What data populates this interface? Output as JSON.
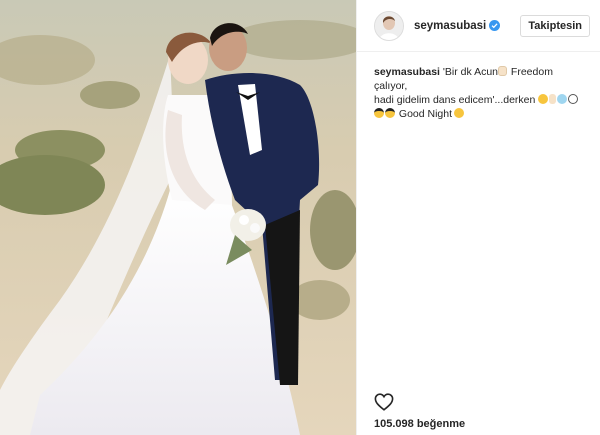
{
  "post": {
    "username": "seymasubasi",
    "follow_label": "Takiptesin",
    "caption_user": "seymasubasi",
    "caption_line1": "'Bir dk Acun",
    "caption_line1b": " Freedom çalıyor,",
    "caption_line2": "hadi gidelim dans edicem'...derken ",
    "caption_line3": " Good Night",
    "likes": "105.098 beğenme"
  },
  "icons": {
    "verified": "verified-badge-icon",
    "like": "heart-outline-icon",
    "emoji": [
      "hand-emoji",
      "hushed-face-emoji",
      "sun-cloud-emoji",
      "bolt-emoji",
      "headphones-emoji",
      "sunglasses-face-emoji",
      "sunglasses-face-emoji",
      "sleeping-face-emoji"
    ]
  },
  "colors": {
    "verified": "#3897f0",
    "button_border": "#dbdbdb",
    "divider": "#efefef"
  }
}
